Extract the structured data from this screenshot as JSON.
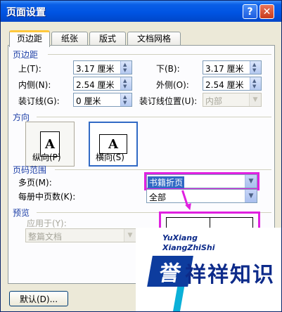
{
  "window": {
    "title": "页面设置",
    "help_label": "?",
    "close_label": "✕"
  },
  "tabs": [
    {
      "label": "页边距",
      "active": true
    },
    {
      "label": "纸张",
      "active": false
    },
    {
      "label": "版式",
      "active": false
    },
    {
      "label": "文档网格",
      "active": false
    }
  ],
  "margins": {
    "section_title": "页边距",
    "top": {
      "label": "上(T):",
      "value": "3.17 厘米"
    },
    "bottom": {
      "label": "下(B):",
      "value": "3.17 厘米"
    },
    "inside": {
      "label": "内侧(N):",
      "value": "2.54 厘米"
    },
    "outside": {
      "label": "外侧(O):",
      "value": "2.54 厘米"
    },
    "gutter": {
      "label": "装订线(G):",
      "value": "0 厘米"
    },
    "gutter_position": {
      "label": "装订线位置(U):",
      "value": "内部"
    }
  },
  "orientation": {
    "section_title": "方向",
    "portrait": {
      "label": "纵向(P)",
      "glyph": "A"
    },
    "landscape": {
      "label": "横向(S)",
      "glyph": "A"
    }
  },
  "pages": {
    "section_title": "页码范围",
    "multiple": {
      "label": "多页(M):",
      "value": "书籍折页"
    },
    "sheets_per_booklet": {
      "label": "每册中页数(K):",
      "value": "全部"
    }
  },
  "preview": {
    "section_title": "预览",
    "apply_to": {
      "label": "应用于(Y):",
      "value": "整篇文档"
    }
  },
  "footer": {
    "default_label": "默认(D)..."
  },
  "watermark": {
    "latin_line1": "YuXiang",
    "latin_line2": "XiangZhiShi",
    "logo_char": "誉",
    "text": "祥祥知识"
  },
  "colors": {
    "highlight": "#e020e0",
    "title_bar": "#0054e3",
    "section_title": "#1c3ea6"
  }
}
